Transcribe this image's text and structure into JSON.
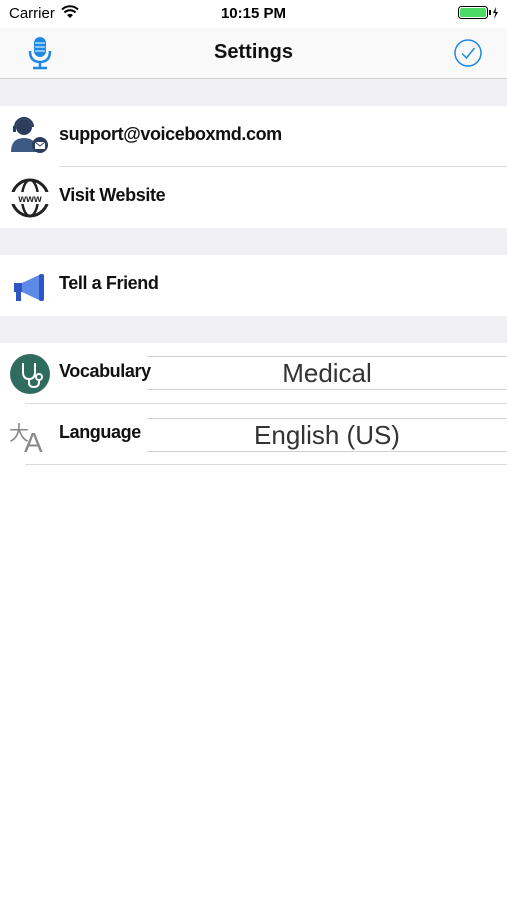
{
  "status_bar": {
    "carrier": "Carrier",
    "time": "10:15 PM"
  },
  "nav": {
    "title": "Settings",
    "left_icon": "microphone-icon",
    "right_icon": "checkmark-circle-icon",
    "accent_color": "#1e88e5"
  },
  "rows": {
    "support_email": "support@voiceboxmd.com",
    "visit_website": "Visit Website",
    "tell_friend": "Tell a Friend",
    "vocabulary_label": "Vocabulary",
    "vocabulary_value": "Medical",
    "language_label": "Language",
    "language_value": "English (US)"
  },
  "colors": {
    "section_gap": "#efeff4",
    "battery": "#4cd964",
    "stethoscope_bg": "#2f6b5f",
    "megaphone": "#2f55c5"
  }
}
